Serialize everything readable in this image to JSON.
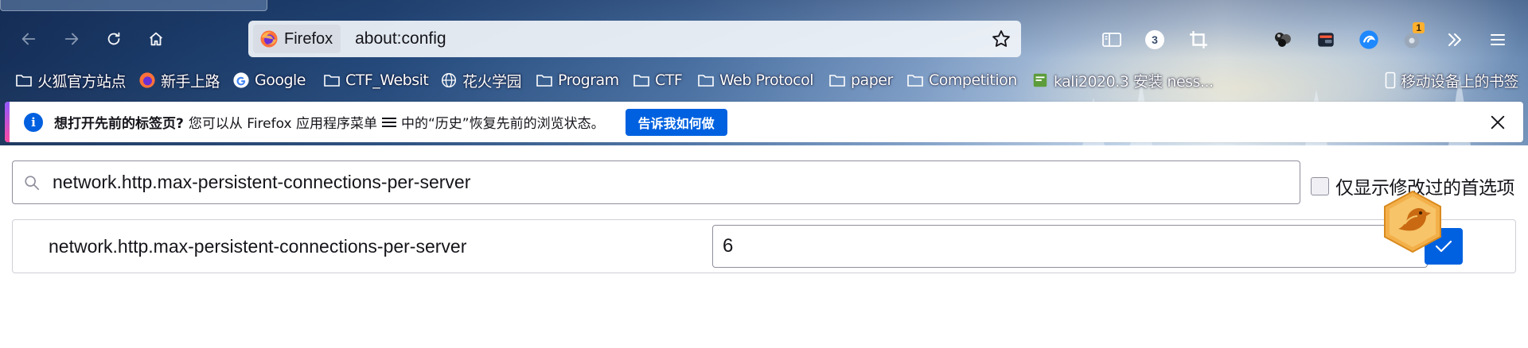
{
  "browser": {
    "name": "Firefox",
    "url": "about:config",
    "extension_badges": {
      "counter": "3",
      "notification": "1"
    }
  },
  "bookmarks": [
    {
      "label": "火狐官方站点",
      "icon": "folder-icon"
    },
    {
      "label": "新手上路",
      "icon": "firefox-icon"
    },
    {
      "label": "Google",
      "icon": "google-icon"
    },
    {
      "label": "CTF_Websit",
      "icon": "folder-icon"
    },
    {
      "label": "花火学园",
      "icon": "globe-icon"
    },
    {
      "label": "Program",
      "icon": "folder-icon"
    },
    {
      "label": "CTF",
      "icon": "folder-icon"
    },
    {
      "label": "Web Protocol",
      "icon": "folder-icon"
    },
    {
      "label": "paper",
      "icon": "folder-icon"
    },
    {
      "label": "Competition",
      "icon": "folder-icon"
    },
    {
      "label": "kali2020.3 安装 ness...",
      "icon": "page-icon"
    },
    {
      "label": "移动设备上的书签",
      "icon": "mobile-icon"
    }
  ],
  "notification": {
    "title": "想打开先前的标签页?",
    "text_before": "您可以从 Firefox 应用程序菜单",
    "text_after": "中的“历史”恢复先前的浏览状态。",
    "button": "告诉我如何做",
    "accent_start": "#9059ff",
    "accent_end": "#ff4aa2"
  },
  "config": {
    "search_value": "network.http.max-persistent-connections-per-server",
    "modified_only_label": "仅显示修改过的首选项",
    "modified_only_checked": false,
    "preference": {
      "name": "network.http.max-persistent-connections-per-server",
      "value": "6"
    }
  },
  "colors": {
    "primary_button": "#0061e0",
    "info_icon": "#0060df",
    "text": "#15141a",
    "border": "#8f8f9d"
  }
}
